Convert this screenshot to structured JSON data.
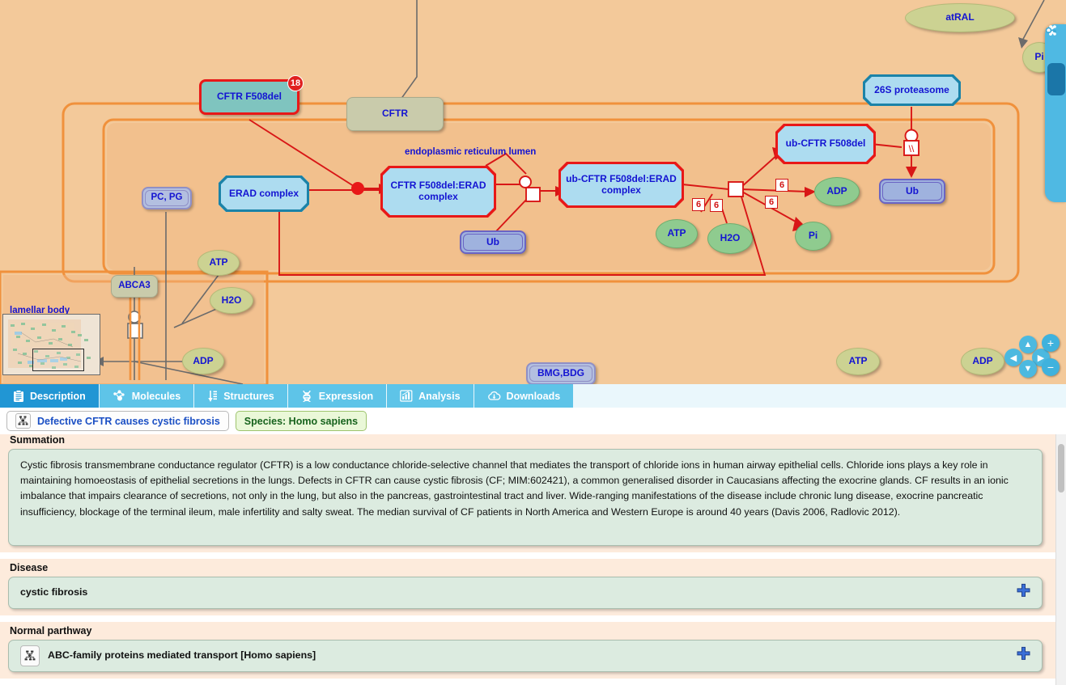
{
  "diagram": {
    "compartment_labels": [
      {
        "text": "endoplasmic reticulum lumen"
      },
      {
        "text": "lamellar body"
      }
    ],
    "nodes": [
      {
        "id": "cftr_f508del",
        "label": "CFTR F508del",
        "badge": "18"
      },
      {
        "id": "cftr",
        "label": "CFTR"
      },
      {
        "id": "erad_complex",
        "label": "ERAD complex"
      },
      {
        "id": "cftr_f508del_erad",
        "label": "CFTR F508del:ERAD complex"
      },
      {
        "id": "ub_cftr_f508del_erad",
        "label": "ub-CFTR F508del:ERAD complex"
      },
      {
        "id": "ub_cftr_f508del",
        "label": "ub-CFTR F508del"
      },
      {
        "id": "proteasome",
        "label": "26S proteasome"
      },
      {
        "id": "ub_1",
        "label": "Ub"
      },
      {
        "id": "ub_2",
        "label": "Ub"
      },
      {
        "id": "pc_pg",
        "label": "PC, PG"
      },
      {
        "id": "abca3",
        "label": "ABCA3"
      },
      {
        "id": "atp_1",
        "label": "ATP"
      },
      {
        "id": "h2o_1",
        "label": "H2O"
      },
      {
        "id": "adp_1",
        "label": "ADP"
      },
      {
        "id": "atp_2",
        "label": "ATP"
      },
      {
        "id": "h2o_2",
        "label": "H2O"
      },
      {
        "id": "adp_2",
        "label": "ADP"
      },
      {
        "id": "pi_1",
        "label": "Pi"
      },
      {
        "id": "pi_2",
        "label": "Pi"
      },
      {
        "id": "atral",
        "label": "atRAL"
      },
      {
        "id": "atp_3",
        "label": "ATP"
      },
      {
        "id": "adp_3",
        "label": "ADP"
      },
      {
        "id": "bmg_bdg",
        "label": "BMG,BDG"
      }
    ],
    "stoichiometry_labels": [
      "6",
      "6",
      "6",
      "6"
    ],
    "minimap": {
      "name": "minimap"
    },
    "nav_controls": [
      {
        "name": "pan-up",
        "glyph": "▲"
      },
      {
        "name": "pan-left",
        "glyph": "◀"
      },
      {
        "name": "pan-right",
        "glyph": "▶"
      },
      {
        "name": "pan-down",
        "glyph": "▼"
      },
      {
        "name": "zoom-in",
        "glyph": "+"
      },
      {
        "name": "zoom-out",
        "glyph": "−"
      }
    ],
    "rail_buttons": [
      {
        "name": "collapse-rail-icon"
      },
      {
        "name": "fireworks-icon"
      },
      {
        "name": "share-icon"
      },
      {
        "name": "info-icon"
      },
      {
        "name": "key-icon"
      }
    ]
  },
  "tabs": [
    {
      "id": "description",
      "label": "Description",
      "icon": "clipboard-icon",
      "active": true
    },
    {
      "id": "molecules",
      "label": "Molecules",
      "icon": "molecule-icon",
      "active": false
    },
    {
      "id": "structures",
      "label": "Structures",
      "icon": "structure-icon",
      "active": false
    },
    {
      "id": "expression",
      "label": "Expression",
      "icon": "dna-icon",
      "active": false
    },
    {
      "id": "analysis",
      "label": "Analysis",
      "icon": "chart-icon",
      "active": false
    },
    {
      "id": "downloads",
      "label": "Downloads",
      "icon": "cloud-download-icon",
      "active": false
    }
  ],
  "breadcrumb": {
    "pathway": "Defective CFTR causes cystic fibrosis",
    "species": "Species: Homo sapiens"
  },
  "sections": {
    "summation": {
      "heading": "Summation",
      "text": "Cystic fibrosis transmembrane conductance regulator (CFTR) is a low conductance chloride-selective channel that mediates the transport of chloride ions in human airway epithelial cells. Chloride ions plays a key role in maintaining homoeostasis of epithelial secretions in the lungs. Defects in CFTR can cause cystic fibrosis (CF; MIM:602421), a common generalised disorder in Caucasians affecting the exocrine glands. CF results in an ionic imbalance that impairs clearance of secretions, not only in the lung, but also in the pancreas, gastrointestinal tract and liver. Wide-ranging manifestations of the disease include chronic lung disease, exocrine pancreatic insufficiency, blockage of the terminal ileum, male infertility and salty sweat. The median survival of CF patients in North America and Western Europe is around 40 years (Davis 2006, Radlovic 2012)."
    },
    "disease": {
      "heading": "Disease",
      "value": "cystic fibrosis"
    },
    "normal_pathway": {
      "heading": "Normal parthway",
      "value": "ABC-family proteins mediated transport [Homo sapiens]"
    }
  },
  "colors": {
    "diagram_background": "#f3c99a",
    "tab_active": "#2196d4",
    "tab_inactive": "#5ec4e8",
    "panel_background": "#fdebdc",
    "box_background": "#dcebe0",
    "highlight_red": "#e81818",
    "node_text": "#1414d2"
  }
}
